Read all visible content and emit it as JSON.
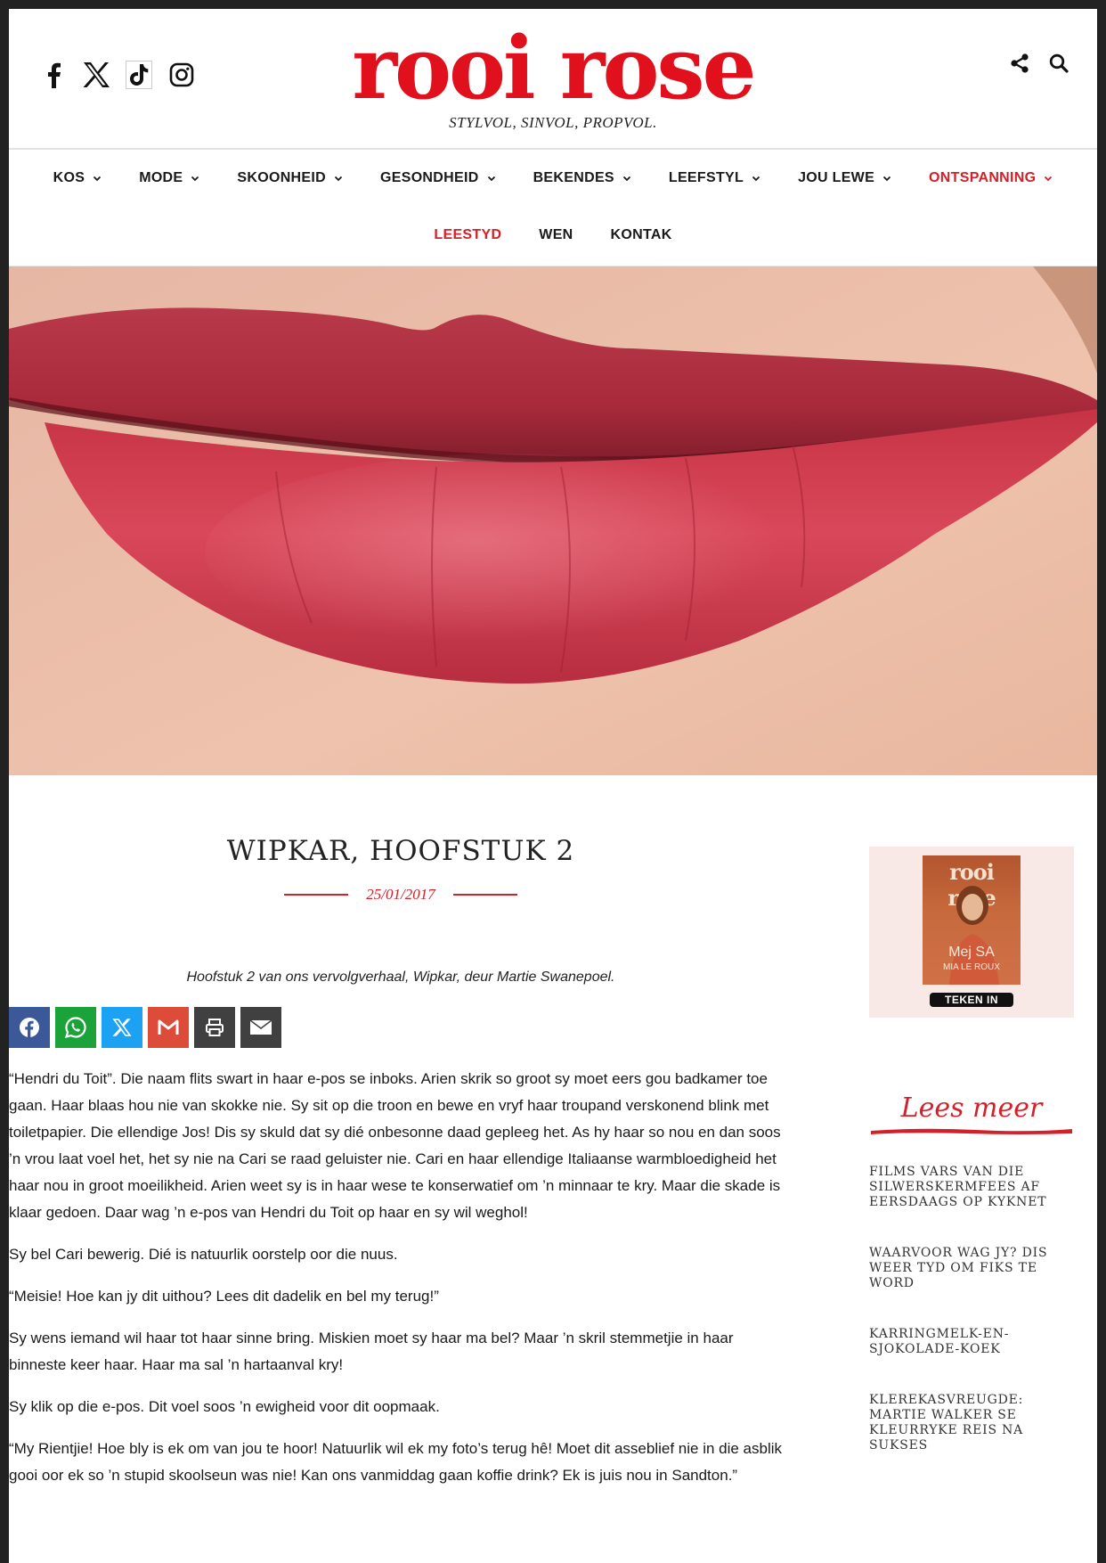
{
  "header": {
    "logo": "rooi rose",
    "tagline": "STYLVOL, SINVOL, PROPVOL.",
    "social_icons": [
      "facebook-icon",
      "x-icon",
      "tiktok-icon",
      "instagram-icon"
    ],
    "right_icons": [
      "share-icon",
      "search-icon"
    ]
  },
  "nav": {
    "row1": [
      {
        "label": "KOS",
        "dropdown": true
      },
      {
        "label": "MODE",
        "dropdown": true
      },
      {
        "label": "SKOONHEID",
        "dropdown": true
      },
      {
        "label": "GESONDHEID",
        "dropdown": true
      },
      {
        "label": "BEKENDES",
        "dropdown": true
      },
      {
        "label": "LEEFSTYL",
        "dropdown": true
      },
      {
        "label": "JOU LEWE",
        "dropdown": true
      },
      {
        "label": "ONTSPANNING",
        "dropdown": true,
        "active": true
      }
    ],
    "row2": [
      {
        "label": "LEESTYD",
        "active": true
      },
      {
        "label": "WEN"
      },
      {
        "label": "KONTAK"
      }
    ]
  },
  "article": {
    "title": "WIPKAR, HOOFSTUK 2",
    "date": "25/01/2017",
    "intro": "Hoofstuk 2 van ons vervolgverhaal, Wipkar, deur Martie Swanepoel.",
    "share_buttons": [
      {
        "icon": "facebook-icon",
        "color": "#3b5998"
      },
      {
        "icon": "whatsapp-icon",
        "color": "#1ba33a"
      },
      {
        "icon": "x-icon",
        "color": "#1da1f2"
      },
      {
        "icon": "gmail-icon",
        "color": "#dd4b39"
      },
      {
        "icon": "print-icon",
        "color": "#404040"
      },
      {
        "icon": "email-icon",
        "color": "#404040"
      }
    ],
    "paragraphs": [
      "“Hendri du Toit”. Die naam flits swart in haar e-pos se inboks. Arien skrik so groot sy moet eers gou badkamer toe gaan. Haar blaas hou nie van skokke nie. Sy sit op die troon en bewe en vryf haar troupand verskonend blink met toiletpapier. Die ellendige Jos! Dis sy skuld dat sy dié onbesonne daad gepleeg het. As hy haar so nou en dan soos ’n vrou laat voel het, het sy nie na Cari se raad geluister nie. Cari en haar ellendige Italiaanse warmbloedigheid het haar nou in groot moeilikheid. Arien weet sy is in haar wese te konserwatief om ’n minnaar te kry. Maar die skade is klaar gedoen. Daar wag ’n e-pos van Hendri  du Toit op haar en sy wil weghol!",
      "Sy bel Cari bewerig. Dié is natuurlik oorstelp oor die nuus.",
      "“Meisie! Hoe kan jy dit uithou? Lees dit dadelik en bel my terug!”",
      "Sy wens iemand wil haar tot haar sinne bring. Miskien moet sy haar ma bel? Maar ’n skril stemmetjie in haar binneste keer haar. Haar ma sal ’n hartaanval kry!",
      "Sy klik op die e-pos. Dit voel soos ’n ewigheid voor dit oopmaak.",
      "“My Rientjie! Hoe bly is ek om van jou te hoor! Natuurlik wil ek my foto’s terug hê! Moet dit asseblief nie in die asblik gooi oor ek so ’n stupid skoolseun was nie! Kan ons vanmiddag gaan koffie drink? Ek is juis nou in Sandton.”"
    ]
  },
  "sidebar": {
    "ad": {
      "cover_logo": "rooi rose",
      "cover_name": "Mej SA",
      "cover_sub": "MIA LE ROUX",
      "button": "TEKEN IN"
    },
    "lees_meer": "Lees meer",
    "related": [
      "FILMS VARS VAN DIE SILWERSKERMFEES AF EERSDAAGS OP KYKNET",
      "WAARVOOR WAG JY? DIS WEER TYD OM FIKS TE WORD",
      "KARRINGMELK-EN-SJOKOLADE-KOEK",
      "KLEREKASVREUGDE: MARTIE WALKER SE KLEURRYKE REIS NA SUKSES"
    ]
  }
}
